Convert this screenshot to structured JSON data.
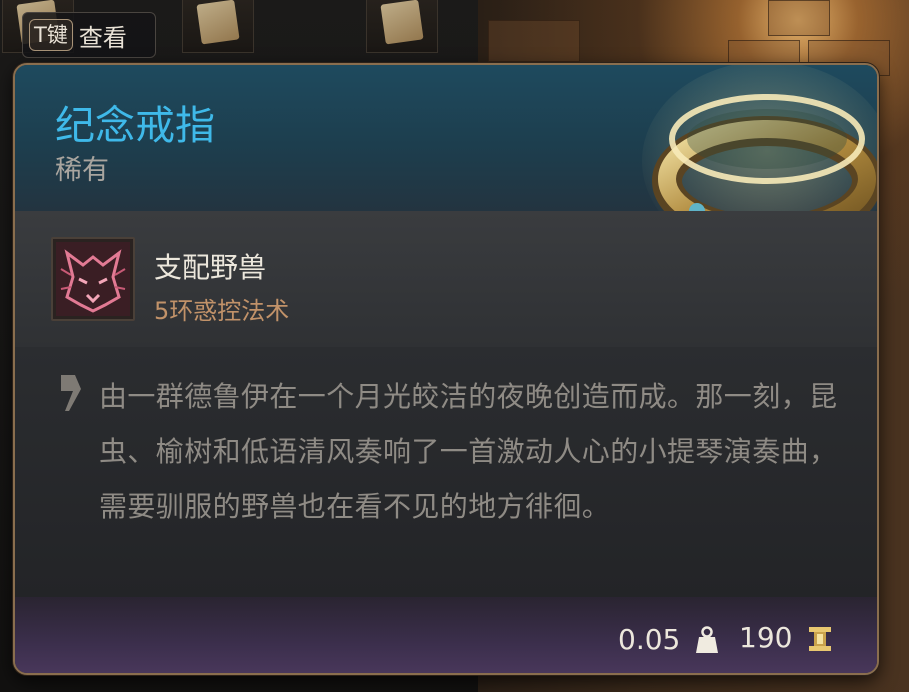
{
  "hotkey": {
    "key": "T键",
    "label": "查看"
  },
  "item": {
    "name": "纪念戒指",
    "rarity": "稀有",
    "icon": "gold-ring-icon",
    "name_color": "#3fb9e9"
  },
  "spell": {
    "name": "支配野兽",
    "level": "5环惑控法术",
    "icon": "beast-face-icon"
  },
  "description": "由一群德鲁伊在一个月光皎洁的夜晚创造而成。那一刻，昆虫、榆树和低语清风奏响了一首激动人心的小提琴演奏曲，需要驯服的野兽也在看不见的地方徘徊。",
  "footer": {
    "weight": "0.05",
    "weight_icon": "weight-icon",
    "price": "190",
    "price_icon": "gold-coin-icon"
  },
  "colors": {
    "border": "#8a6e4e",
    "header_bg": "#1e4a5e",
    "footer_bg": "#3c2f4d",
    "spell_level": "#c19269"
  }
}
